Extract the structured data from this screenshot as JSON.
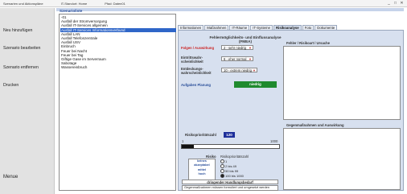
{
  "topbar": {
    "items": [
      "Szenarien und Aktionspläne",
      "IT-Standort: Home",
      "Pfad: Daten01"
    ],
    "controls": [
      "_",
      "□",
      "✕"
    ]
  },
  "nav": {
    "buttons": [
      "Neu hinzufügen",
      "Szenario bearbeiten",
      "Szenario entfernen",
      "Drucken",
      "Menue"
    ]
  },
  "scenarios": {
    "title": "Szenarioliste",
    "items": [
      "-01",
      "Ausfall der Stromversorgung",
      "Ausfall IT-Services allgemein",
      "Ausfall IT-Services Informationsverbund",
      "Ausfall LAN",
      "Ausfall Telefonzentrale",
      "Ausfall USV",
      "Einbruch",
      "Feuer bei Nacht",
      "Feuer bei Tag",
      "Giftige Gase im Serverraum",
      "Sabotage",
      "Wassereinbruch"
    ],
    "selected_index": 3
  },
  "tabs": [
    "Informationen",
    "Maßnahmen",
    "IT-Räume",
    "IT-Systeme",
    "Risikoanalyse",
    "Foto",
    "Dokumente"
  ],
  "active_tab_index": 4,
  "fmea": {
    "title": "Fehlermöglichkeits- und Einflussanalyse (FMEA)",
    "folgen_label": "Folgen / Auswirkung",
    "folgen_value": "2 - sehr niedrig",
    "eintritt_label": "Eintrittswahr-scheinlichkeit",
    "eintritt_value": "6 - eher normal",
    "entdeckung_label": "Entdeckungs-wahrscheinlichkeit",
    "entdeckung_value": "10 - extrem niedrig",
    "planung_label": "Aufgaben Planung",
    "planung_button": "niedrig"
  },
  "fehler": {
    "title": "Fehler / Risikoart / Ursache",
    "value": ""
  },
  "gegen": {
    "title": "Gegenmaßnahmen und Auswirkung",
    "value": ""
  },
  "rpz": {
    "label": "Risikoprioritätszahl",
    "value": "120",
    "min_label": "1",
    "max_label": "1000",
    "fraction": 0.12
  },
  "risk": {
    "title": "Risiko",
    "legend": [
      "keines",
      "akzeptabel",
      "mittel",
      "hoch"
    ],
    "rpz_title": "Risikoprioritätszahl",
    "options": [
      "1",
      "2 bis 49",
      "50 bis 99",
      "100 bis 1000"
    ],
    "selected_index": 3
  },
  "handlung": {
    "label": "dringender Handlungsbedarf",
    "note": "Gegenmaßnahmen müssen formuliert und umgesetzt werden"
  }
}
